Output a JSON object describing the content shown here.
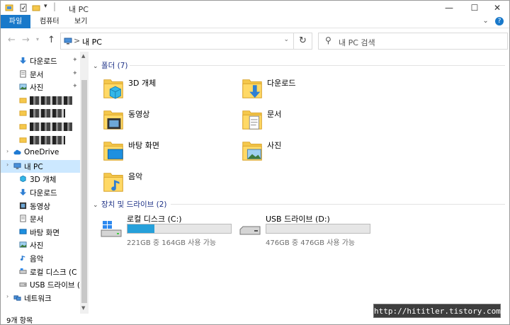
{
  "window": {
    "title": "내 PC",
    "minimize_glyph": "—",
    "maximize_glyph": "☐",
    "close_glyph": "✕"
  },
  "ribbon": {
    "tabs": [
      "파일",
      "컴퓨터",
      "보기"
    ],
    "expand_glyph": "⌄",
    "help_glyph": "?"
  },
  "nav": {
    "back_icon": "arrow-left-icon",
    "forward_icon": "arrow-right-icon",
    "recent_icon": "chevron-down-icon",
    "up_icon": "arrow-up-icon"
  },
  "address": {
    "separator": ">",
    "path": "내 PC"
  },
  "search": {
    "placeholder": "내 PC 검색"
  },
  "sidebar": {
    "items": [
      {
        "label": "다운로드",
        "icon": "download-arrow-icon",
        "pinned": true
      },
      {
        "label": "문서",
        "icon": "document-icon",
        "pinned": true
      },
      {
        "label": "사진",
        "icon": "pictures-icon",
        "pinned": true
      },
      {
        "label": "",
        "icon": "folder-icon",
        "pinned": false
      },
      {
        "label": "",
        "icon": "folder-icon",
        "pinned": false
      },
      {
        "label": "",
        "icon": "folder-icon",
        "pinned": false
      },
      {
        "label": "",
        "icon": "folder-icon",
        "pinned": false
      },
      {
        "label": "OneDrive",
        "icon": "cloud-icon",
        "pinned": false
      },
      {
        "label": "내 PC",
        "icon": "computer-icon",
        "pinned": false,
        "selected": true
      },
      {
        "label": "3D 개체",
        "icon": "cube-icon",
        "pinned": false
      },
      {
        "label": "다운로드",
        "icon": "download-arrow-icon",
        "pinned": false
      },
      {
        "label": "동영상",
        "icon": "film-icon",
        "pinned": false
      },
      {
        "label": "문서",
        "icon": "document-icon",
        "pinned": false
      },
      {
        "label": "바탕 화면",
        "icon": "desktop-icon",
        "pinned": false
      },
      {
        "label": "사진",
        "icon": "pictures-icon",
        "pinned": false
      },
      {
        "label": "음악",
        "icon": "music-note-icon",
        "pinned": false
      },
      {
        "label": "로컬 디스크 (C",
        "icon": "drive-icon",
        "pinned": false
      },
      {
        "label": "USB 드라이브 (",
        "icon": "usb-drive-icon",
        "pinned": false
      },
      {
        "label": "네트워크",
        "icon": "network-icon",
        "pinned": false
      }
    ],
    "pin_glyph": "📌"
  },
  "folders_group": {
    "title": "폴더 (7)",
    "items": [
      {
        "label": "3D 개체",
        "icon": "cube-folder-icon"
      },
      {
        "label": "다운로드",
        "icon": "download-folder-icon"
      },
      {
        "label": "동영상",
        "icon": "video-folder-icon"
      },
      {
        "label": "문서",
        "icon": "document-folder-icon"
      },
      {
        "label": "바탕 화면",
        "icon": "desktop-folder-icon"
      },
      {
        "label": "사진",
        "icon": "pictures-folder-icon"
      },
      {
        "label": "음악",
        "icon": "music-folder-icon"
      }
    ]
  },
  "drives_group": {
    "title": "장치 및 드라이브 (2)",
    "items": [
      {
        "label": "로컬 디스크 (C:)",
        "detail": "221GB 중 164GB 사용 가능",
        "used_fraction": 0.26,
        "icon": "windows-drive-icon"
      },
      {
        "label": "USB 드라이브 (D:)",
        "detail": "476GB 중 476GB 사용 가능",
        "used_fraction": 0.0,
        "icon": "usb-drive-icon"
      }
    ]
  },
  "status": {
    "item_count": "9개 항목"
  },
  "watermark": "http://hititler.tistory.com",
  "colors": {
    "accent": "#1979ca",
    "folder": "#f5c84c",
    "drive_bar": "#26a0da",
    "selected": "#cce8ff"
  }
}
